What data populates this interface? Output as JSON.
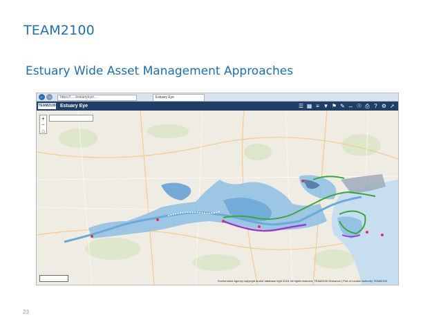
{
  "slide": {
    "title": "TEAM2100",
    "subtitle": "Estuary Wide Asset Management Approaches",
    "page_number": "23"
  },
  "browser": {
    "url": "https://...../estuaryeye/...",
    "tab_label": "Estuary Eye"
  },
  "app": {
    "logo_text": "TEAM2100",
    "name": "Estuary Eye",
    "toolbar": [
      "layers-icon",
      "grid-icon",
      "list-icon",
      "filter-icon",
      "bookmark-icon",
      "draw-icon",
      "measure-icon",
      "locate-icon",
      "print-icon",
      "help-icon",
      "settings-icon",
      "share-icon"
    ]
  },
  "map": {
    "attribution": "Environment Agency copyright and/or database right 2016. All rights reserved. TEAM2100 Ordnance | Port of London Authority TEAM2100"
  },
  "colors": {
    "title": "#1e6fa6",
    "app_header": "#1f3f66",
    "water": "#9ec9e6",
    "defence_green": "#3aa63a",
    "defence_purple": "#9b3ac8"
  }
}
